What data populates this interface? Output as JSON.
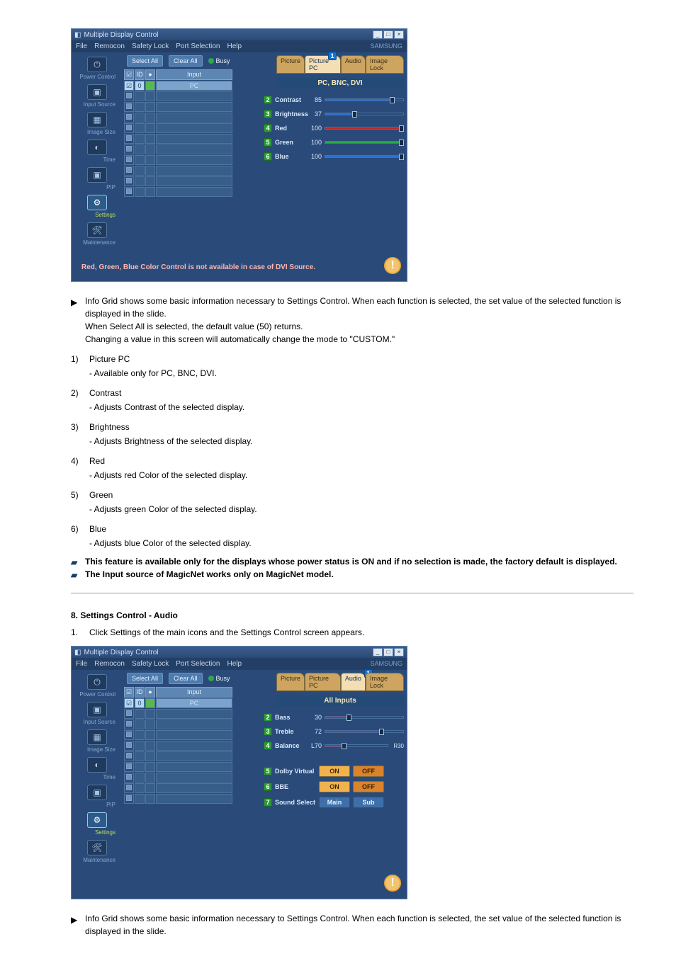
{
  "app": {
    "title": "Multiple Display Control",
    "menu": [
      "File",
      "Remocon",
      "Safety Lock",
      "Port Selection",
      "Help"
    ],
    "brand": "SAMSUNG",
    "selectAll": "Select All",
    "clearAll": "Clear All",
    "busy": "Busy",
    "gridHeaders": {
      "check": "☑",
      "id": "ID",
      "lamp": "●",
      "input": "Input"
    },
    "row1_id": "0",
    "row1_input": "PC",
    "nav": {
      "power": "Power Control",
      "inputSource": "Input Source",
      "imageSize": "Image Size",
      "time": "Time",
      "pip": "PIP",
      "settings": "Settings",
      "maintenance": "Maintenance"
    }
  },
  "picture": {
    "tabs": {
      "picture": "Picture",
      "picturePC": "Picture PC",
      "audio": "Audio",
      "imageLock": "Image Lock"
    },
    "mode": "PC, BNC, DVI",
    "sliders": {
      "contrast": {
        "label": "Contrast",
        "value": "85",
        "percent": 85,
        "color": "blue"
      },
      "brightness": {
        "label": "Brightness",
        "value": "37",
        "percent": 37,
        "color": "blue"
      },
      "red": {
        "label": "Red",
        "value": "100",
        "percent": 100,
        "color": "red"
      },
      "green": {
        "label": "Green",
        "value": "100",
        "percent": 100,
        "color": "green"
      },
      "blue": {
        "label": "Blue",
        "value": "100",
        "percent": 100,
        "color": "blue"
      }
    },
    "footerMsg": "Red, Green, Blue Color Control is not available in case of DVI Source."
  },
  "audio": {
    "mode": "All Inputs",
    "sliders": {
      "bass": {
        "label": "Bass",
        "value": "30",
        "percent": 30
      },
      "treble": {
        "label": "Treble",
        "value": "72",
        "percent": 72
      },
      "balance": {
        "label": "Balance",
        "left": "L70",
        "right": "R30",
        "percent": 30
      }
    },
    "toggles": {
      "dolby": {
        "label": "Dolby Virtual",
        "on": "ON",
        "off": "OFF"
      },
      "bbe": {
        "label": "BBE",
        "on": "ON",
        "off": "OFF"
      },
      "soundSelect": {
        "label": "Sound Select",
        "a": "Main",
        "b": "Sub"
      }
    }
  },
  "doc": {
    "intro1": "Info Grid shows some basic information necessary to Settings Control. When each function is selected, the set value of the selected function is displayed in the slide.",
    "intro2": "When Select All is selected, the default value (50) returns.",
    "intro3": "Changing a value in this screen will automatically change the mode to \"CUSTOM.\"",
    "items": {
      "1": {
        "t": "Picture PC",
        "d": "- Available only for PC, BNC, DVI."
      },
      "2": {
        "t": "Contrast",
        "d": "- Adjusts Contrast of the selected display."
      },
      "3": {
        "t": "Brightness",
        "d": "- Adjusts Brightness of the selected display."
      },
      "4": {
        "t": "Red",
        "d": "- Adjusts red Color of the selected display."
      },
      "5": {
        "t": "Green",
        "d": "- Adjusts green Color of the selected display."
      },
      "6": {
        "t": "Blue",
        "d": "- Adjusts blue Color of the selected display."
      }
    },
    "note1": "This feature is available only for the displays whose power status is ON and if no selection is made, the factory default is displayed.",
    "note2": "The Input source of MagicNet works only on MagicNet model.",
    "sec8_title": "8. Settings Control - Audio",
    "sec8_step1": "Click Settings of the main icons and the Settings Control screen appears.",
    "outro1": "Info Grid shows some basic information necessary to Settings Control. When each function is selected, the set value of the selected function is displayed in the slide."
  }
}
